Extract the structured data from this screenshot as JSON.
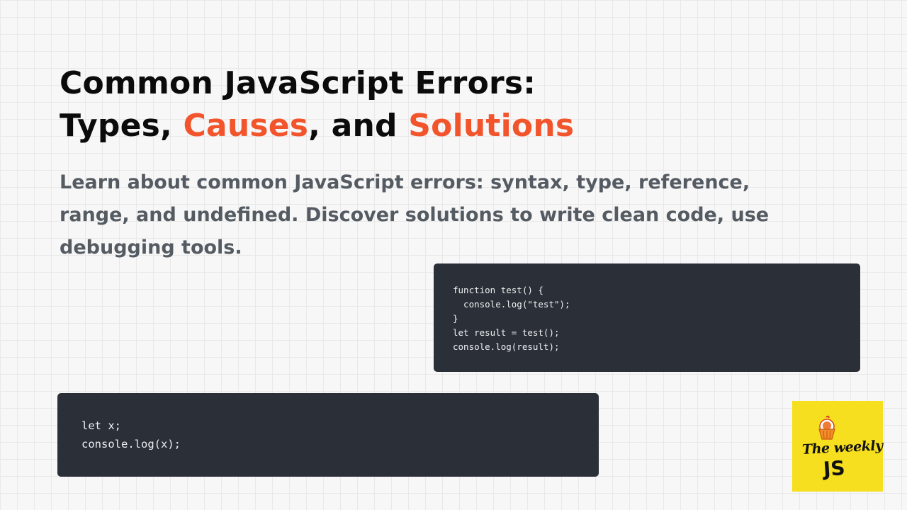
{
  "heading": {
    "line1": "Common JavaScript Errors:",
    "line2_prefix": "Types, ",
    "line2_accent1": "Causes",
    "line2_middle": ", and ",
    "line2_accent2": "Solutions"
  },
  "description": {
    "line1": "Learn about common JavaScript errors: syntax, type, reference,",
    "line2": "range, and undefined. Discover solutions to write clean code, use",
    "line3": "debugging tools."
  },
  "code_snippets": {
    "function_example": "function test() {\n  console.log(\"test\");\n}\nlet result = test();\nconsole.log(result);",
    "undefined_example": "let x;\nconsole.log(x);"
  },
  "logo": {
    "icon": "cupcake-icon",
    "line1": "The weekly",
    "line2": "JS"
  },
  "colors": {
    "accent": "#f2552c",
    "code_background": "#2b3038",
    "logo_background": "#f6df1e"
  }
}
